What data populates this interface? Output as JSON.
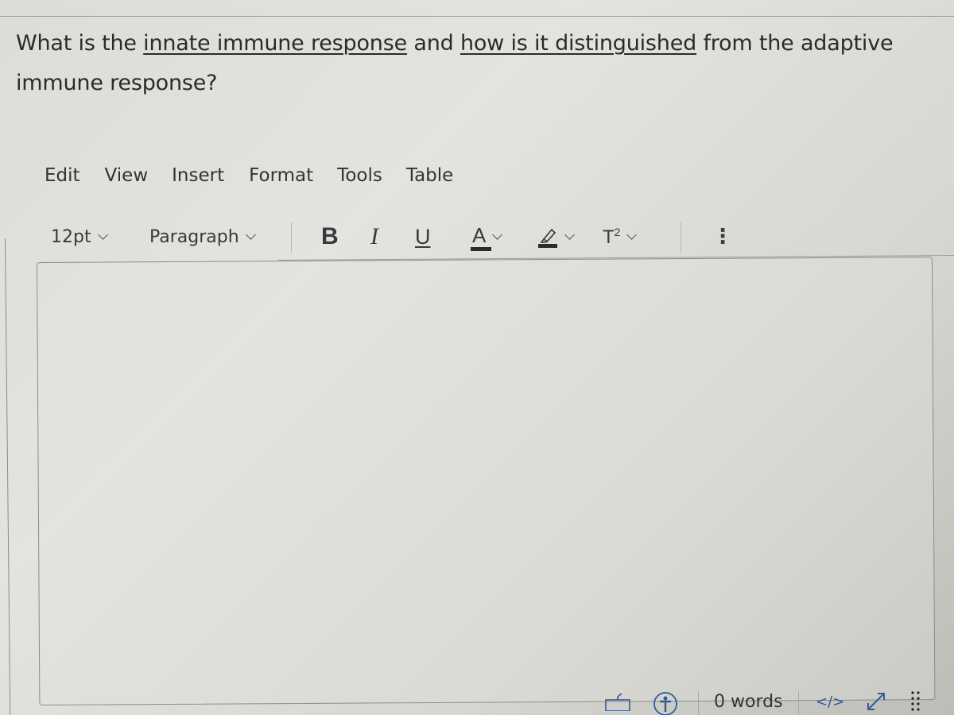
{
  "question": {
    "parts": [
      {
        "text": "What is the ",
        "underline": false
      },
      {
        "text": "innate immune response",
        "underline": true
      },
      {
        "text": " and ",
        "underline": false
      },
      {
        "text": "how is it distinguished",
        "underline": true
      },
      {
        "text": " from the adaptive immune response?",
        "underline": false
      }
    ]
  },
  "menubar": {
    "items": [
      {
        "label": "Edit"
      },
      {
        "label": "View"
      },
      {
        "label": "Insert"
      },
      {
        "label": "Format"
      },
      {
        "label": "Tools"
      },
      {
        "label": "Table"
      }
    ]
  },
  "toolbar": {
    "font_size": "12pt",
    "block_format": "Paragraph",
    "bold": "B",
    "italic": "I",
    "underline": "U",
    "text_color": "A",
    "superscript": "T",
    "superscript_exp": "2",
    "more": "⋮"
  },
  "editor": {
    "content": ""
  },
  "statusbar": {
    "word_count": "0 words",
    "html_toggle": "</>",
    "accent_color": "#2f5b9a"
  }
}
